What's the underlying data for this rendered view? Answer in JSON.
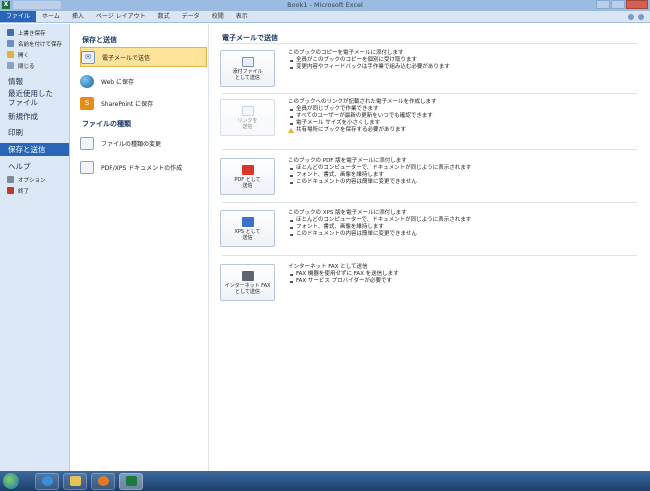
{
  "window": {
    "app_logo": "X",
    "title": "Book1 - Microsoft Excel"
  },
  "ribbon": {
    "tabs": [
      "ファイル",
      "ホーム",
      "挿入",
      "ページ レイアウト",
      "数式",
      "データ",
      "校閲",
      "表示"
    ]
  },
  "left_nav": {
    "small_items": [
      {
        "label": "上書き保存",
        "icon": "save-icon"
      },
      {
        "label": "名前を付けて保存",
        "icon": "save-as-icon"
      },
      {
        "label": "開く",
        "icon": "open-folder-icon"
      },
      {
        "label": "閉じる",
        "icon": "close-file-icon"
      }
    ],
    "info": "情報",
    "recent_line1": "最近使用した",
    "recent_line2": "ファイル",
    "new": "新規作成",
    "print": "印刷",
    "save_send": "保存と送信",
    "help": "ヘルプ",
    "options": "オプション",
    "exit": "終了"
  },
  "middle": {
    "save_send_heading": "保存と送信",
    "items": [
      {
        "label": "電子メールで送信",
        "icon": "email-icon"
      },
      {
        "label": "Web に保存",
        "icon": "globe-icon"
      },
      {
        "label": "SharePoint に保存",
        "icon": "sharepoint-icon"
      }
    ],
    "file_types_heading": "ファイルの種類",
    "file_items": [
      {
        "label": "ファイルの種類の変更",
        "icon": "file-type-icon"
      },
      {
        "label": "PDF/XPS ドキュメントの作成",
        "icon": "pdf-document-icon"
      }
    ]
  },
  "content": {
    "title": "電子メールで送信",
    "sections": [
      {
        "button": "添付ファイル\nとして送信",
        "icon": "attachment-icon",
        "enabled": true,
        "title": "このブックのコピーを電子メールに添付します",
        "bullets": [
          "全員がこのブックのコピーを個別に受け取ります",
          "変更内容やフィードバックは手作業で組み込む必要があります"
        ],
        "warning": ""
      },
      {
        "button": "リンクを\n送信",
        "icon": "link-icon",
        "enabled": false,
        "title": "このブックへのリンクが記載された電子メールを作成します",
        "bullets": [
          "全員が同じブックで作業できます",
          "すべてのユーザーが最新の更新をいつでも確認できます",
          "電子メール サイズを小さくします"
        ],
        "warning": "共有場所にブックを保存する必要があります"
      },
      {
        "button": "PDF として\n送信",
        "icon": "pdf-icon",
        "enabled": true,
        "title": "このブックの PDF 版を電子メールに添付します",
        "bullets": [
          "ほとんどのコンピューターで、ドキュメントが同じように表示されます",
          "フォント、書式、画像を維持します",
          "このドキュメントの内容は簡単に変更できません"
        ],
        "warning": ""
      },
      {
        "button": "XPS として\n送信",
        "icon": "xps-icon",
        "enabled": true,
        "title": "このブックの XPS 版を電子メールに添付します",
        "bullets": [
          "ほとんどのコンピューターで、ドキュメントが同じように表示されます",
          "フォント、書式、画像を維持します",
          "このドキュメントの内容は簡単に変更できません"
        ],
        "warning": ""
      },
      {
        "button": "インターネット FAX\nとして送信",
        "icon": "fax-icon",
        "enabled": true,
        "title": "インターネット FAX として送信",
        "bullets": [
          "FAX 機器を使用せずに FAX を送信します",
          "FAX サービス プロバイダーが必要です"
        ],
        "warning": ""
      }
    ]
  },
  "taskbar": {
    "items": [
      "start-orb-icon",
      "ie-icon",
      "explorer-icon",
      "media-player-icon",
      "excel-icon"
    ]
  },
  "colors": {
    "active_tab": "#2a66b8",
    "nav_bg": "#dde8f6",
    "selected_item": "#fde49a"
  }
}
